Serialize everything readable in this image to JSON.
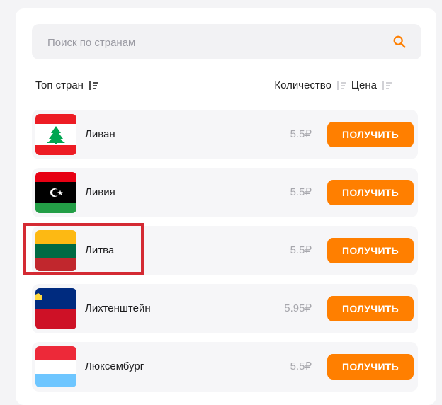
{
  "search": {
    "placeholder": "Поиск по странам"
  },
  "header": {
    "top_label": "Топ стран",
    "quantity_label": "Количество",
    "price_label": "Цена"
  },
  "countries": [
    {
      "name": "Ливан",
      "price": "5.5₽",
      "button": "ПОЛУЧИТЬ"
    },
    {
      "name": "Ливия",
      "price": "5.5₽",
      "button": "ПОЛУЧИТЬ"
    },
    {
      "name": "Литва",
      "price": "5.5₽",
      "button": "ПОЛУЧИТЬ"
    },
    {
      "name": "Лихтенштейн",
      "price": "5.95₽",
      "button": "ПОЛУЧИТЬ"
    },
    {
      "name": "Люксембург",
      "price": "5.5₽",
      "button": "ПОЛУЧИТЬ"
    }
  ],
  "colors": {
    "accent": "#ff7f00",
    "highlight": "#d42a33"
  },
  "icons": {
    "search": "search-icon",
    "sort": "sort-icon"
  }
}
